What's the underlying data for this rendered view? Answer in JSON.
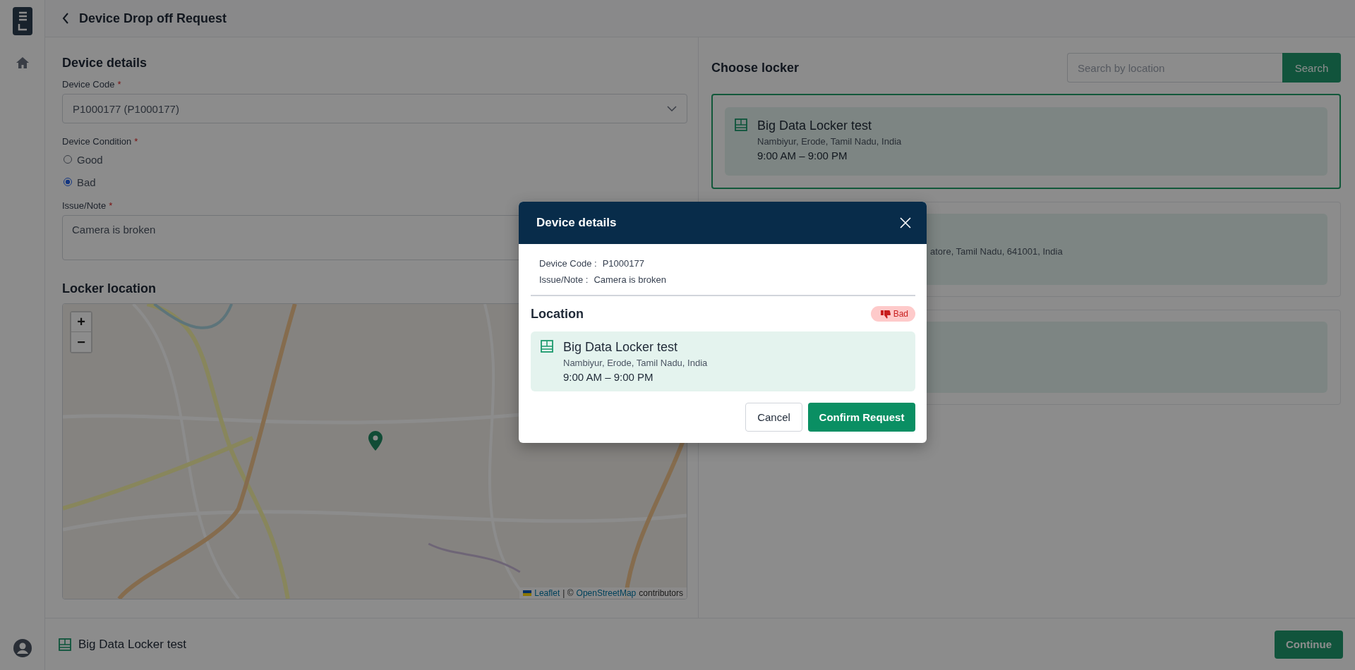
{
  "header": {
    "title": "Device Drop off Request"
  },
  "device_details": {
    "title": "Device details",
    "device_code": {
      "label": "Device Code",
      "required_mark": "*",
      "value": "P1000177 (P1000177)"
    },
    "device_condition": {
      "label": "Device Condition",
      "required_mark": "*",
      "options": [
        {
          "label": "Good",
          "selected": false
        },
        {
          "label": "Bad",
          "selected": true
        }
      ]
    },
    "issue_note": {
      "label": "Issue/Note",
      "required_mark": "*",
      "value": "Camera is broken"
    }
  },
  "locker_location": {
    "title": "Locker location",
    "map": {
      "zoom_in": "+",
      "zoom_out": "−",
      "attribution": {
        "leaflet": "Leaflet",
        "separator": "| ©",
        "osm": "OpenStreetMap",
        "suffix": "contributors"
      }
    }
  },
  "choose_locker": {
    "title": "Choose locker",
    "search": {
      "placeholder": "Search by location",
      "button": "Search"
    },
    "lockers": [
      {
        "kind": "full",
        "name": "Big Data Locker test",
        "address": "Nambiyur, Erode, Tamil Nadu, India",
        "hours": "9:00 AM – 9:00 PM",
        "selected": true
      },
      {
        "kind": "covered",
        "address": "atore, Tamil Nadu, 641001, India",
        "selected": false
      },
      {
        "kind": "covered",
        "selected": false
      }
    ]
  },
  "footer": {
    "locker_name": "Big Data Locker test",
    "continue": "Continue"
  },
  "modal": {
    "title": "Device details",
    "fields": [
      {
        "label": "Device Code :",
        "value": "P1000177"
      },
      {
        "label": "Issue/Note :",
        "value": "Camera is broken"
      }
    ],
    "location_title": "Location",
    "condition_badge": "Bad",
    "locker": {
      "name": "Big Data Locker test",
      "address": "Nambiyur, Erode, Tamil Nadu, India",
      "hours": "9:00 AM – 9:00 PM"
    },
    "buttons": {
      "cancel": "Cancel",
      "confirm": "Confirm Request"
    }
  }
}
